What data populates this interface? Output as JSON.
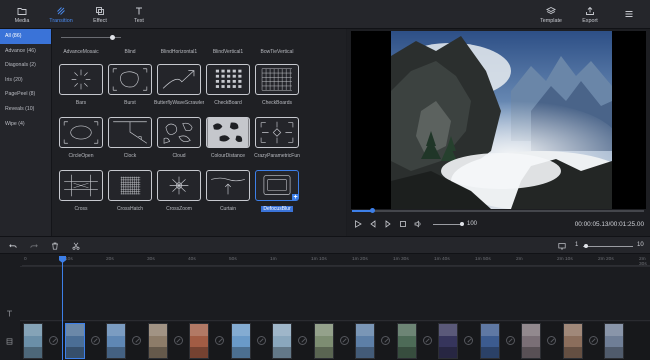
{
  "toolbar": {
    "media": "Media",
    "transition": "Transition",
    "effect": "Effect",
    "text": "Text",
    "template": "Template",
    "export": "Export"
  },
  "categories": [
    {
      "label": "All (86)"
    },
    {
      "label": "Advance (46)"
    },
    {
      "label": "Diagonals (2)"
    },
    {
      "label": "Iris (20)"
    },
    {
      "label": "PagePeel (8)"
    },
    {
      "label": "Reveals (10)"
    },
    {
      "label": "Wipe (4)"
    }
  ],
  "grid": {
    "top_names": [
      "AdvanceMosaic",
      "Blind",
      "BlindHorizontal1",
      "BlindVertical1",
      "BowTieVertical"
    ],
    "items": [
      {
        "label": "Bars",
        "icon": "bars-icon"
      },
      {
        "label": "Burst",
        "icon": "burst-icon"
      },
      {
        "label": "ButterflyWaveScrawler",
        "icon": "butterfly-wave-icon"
      },
      {
        "label": "CheckBoard",
        "icon": "checkboard-icon"
      },
      {
        "label": "CheckBoards",
        "icon": "checkboards-icon"
      },
      {
        "label": "CircleOpen",
        "icon": "circle-open-icon"
      },
      {
        "label": "Clock",
        "icon": "clock-icon"
      },
      {
        "label": "Cloud",
        "icon": "cloud-icon"
      },
      {
        "label": "ColourDistance",
        "icon": "colour-distance-icon"
      },
      {
        "label": "CrazyParametricFun",
        "icon": "crazy-parametric-icon"
      },
      {
        "label": "Cross",
        "icon": "cross-icon"
      },
      {
        "label": "CrossHatch",
        "icon": "crosshatch-icon"
      },
      {
        "label": "CrossZoom",
        "icon": "crosszoom-icon"
      },
      {
        "label": "Curtain",
        "icon": "curtain-icon"
      },
      {
        "label": "DefocusBlur",
        "icon": "defocus-blur-icon",
        "selected": true
      }
    ]
  },
  "player": {
    "progress": 0.07,
    "volume": "100",
    "timecode": "00:00:05.13/00:01:25.00"
  },
  "timeline_bar": {
    "zoom_min": "1",
    "zoom_max": "10",
    "zoom_level": 0.05
  },
  "ruler_ticks": [
    "0",
    "10s",
    "20s",
    "30s",
    "40s",
    "50s",
    "1m",
    "1m 10s",
    "1m 20s",
    "1m 30s",
    "1m 40s",
    "1m 50s",
    "2m",
    "2m 10s",
    "2m 20s",
    "2m 30s"
  ],
  "clips": [
    {
      "color": "#6b8fa8"
    },
    {
      "color": "#4b6e95",
      "selected": true
    },
    {
      "color": "#5f87b4"
    },
    {
      "color": "#8d7c69"
    },
    {
      "color": "#a25c44"
    },
    {
      "color": "#6a9ac8"
    },
    {
      "color": "#8aa7bd"
    },
    {
      "color": "#7d8d72"
    },
    {
      "color": "#5d7fa7"
    },
    {
      "color": "#4d6b57"
    },
    {
      "color": "#36355c"
    },
    {
      "color": "#3c5b8f"
    },
    {
      "color": "#7a6f76"
    },
    {
      "color": "#8b6e5c"
    },
    {
      "color": "#6f7e96"
    }
  ]
}
